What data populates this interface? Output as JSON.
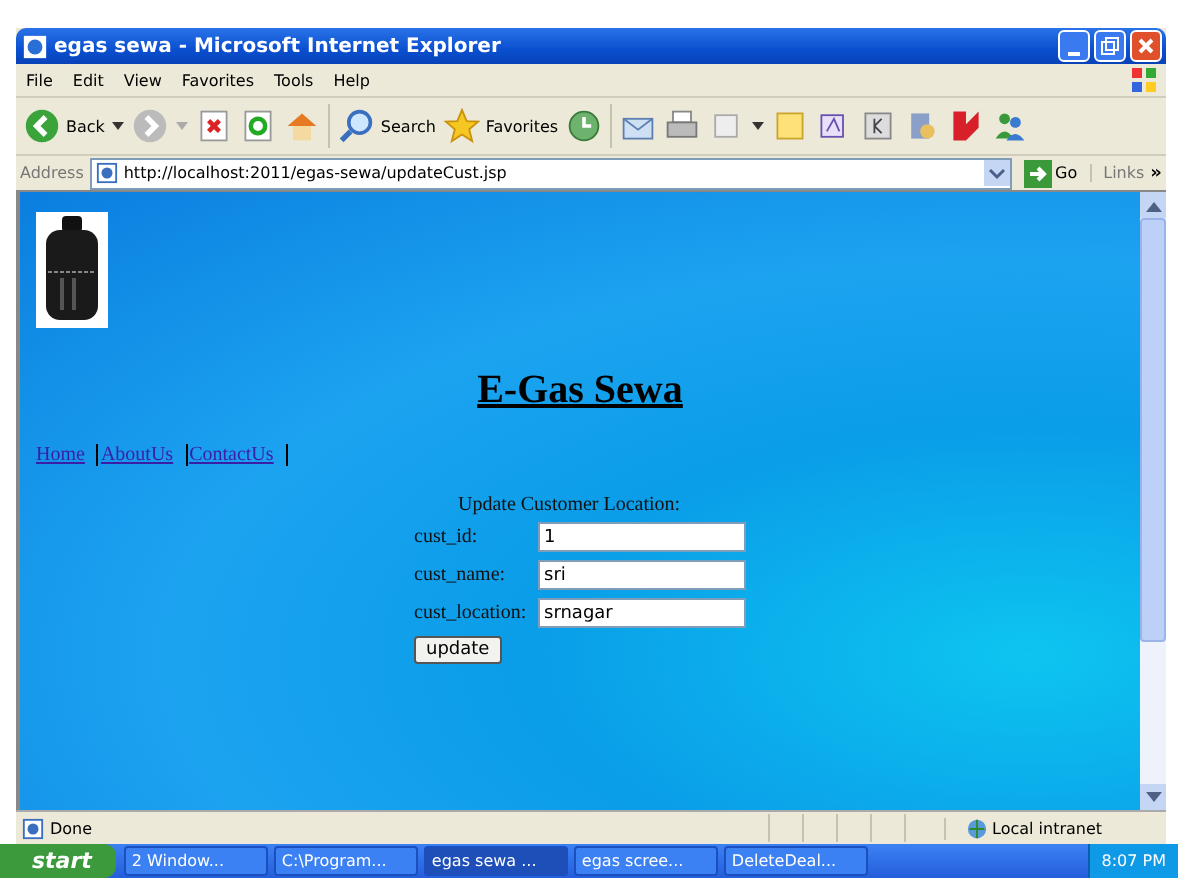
{
  "window": {
    "title": "egas sewa - Microsoft Internet Explorer"
  },
  "menu": [
    "File",
    "Edit",
    "View",
    "Favorites",
    "Tools",
    "Help"
  ],
  "toolbar": {
    "back": "Back",
    "search": "Search",
    "favorites": "Favorites"
  },
  "address_bar": {
    "label": "Address",
    "url": "http://localhost:2011/egas-sewa/updateCust.jsp",
    "go": "Go",
    "links": "Links",
    "more": "»"
  },
  "page": {
    "heading": "E-Gas Sewa",
    "nav": [
      {
        "label": "Home"
      },
      {
        "label": "AboutUs"
      },
      {
        "label": "ContactUs"
      }
    ],
    "form_title": "Update Customer Location:",
    "fields": [
      {
        "label": "cust_id:",
        "value": "1"
      },
      {
        "label": "cust_name:",
        "value": "sri"
      },
      {
        "label": "cust_location:",
        "value": "srnagar"
      }
    ],
    "submit": "update"
  },
  "status_bar": {
    "text": "Done",
    "zone": "Local intranet"
  },
  "taskbar": {
    "start": "start",
    "items": [
      {
        "label": "2 Window...",
        "selected": false
      },
      {
        "label": "C:\\Program...",
        "selected": false
      },
      {
        "label": "egas sewa ...",
        "selected": true
      },
      {
        "label": "egas scree...",
        "selected": false
      },
      {
        "label": "DeleteDeal...",
        "selected": false
      }
    ],
    "clock": "8:07 PM"
  }
}
